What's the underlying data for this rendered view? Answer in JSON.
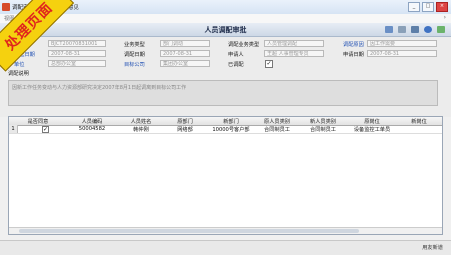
{
  "window": {
    "title": "调配审批",
    "tab": "审批意见",
    "menu": [
      "视图",
      "文件"
    ]
  },
  "page_title": "人员调配审批",
  "form": {
    "row1": [
      {
        "label": "单号",
        "value": "BJCT20070831001"
      },
      {
        "label": "业务类型",
        "value": "部门调动"
      },
      {
        "label": "调配业务类型",
        "value": "人员管理调配"
      },
      {
        "label": "调配原因",
        "value": "因工作需要"
      }
    ],
    "row2": [
      {
        "label": "发起日期",
        "value": "2007-08-31"
      },
      {
        "label": "调配日期",
        "value": "2007-08-31"
      },
      {
        "label": "申请人",
        "value": "王超 人事管理专员"
      },
      {
        "label": "申请日期",
        "value": "2007-08-31"
      }
    ],
    "row3": [
      {
        "label": "单位",
        "value": "总部办公室"
      },
      {
        "label": "目标公司",
        "value": "集团办公室"
      },
      {
        "label": "已调配",
        "value": ""
      }
    ],
    "memo_label": "调配说明",
    "memo_text": "因新工作任务变动与人力资源部研究决定2007年8月1日起调离到目标公司工作"
  },
  "grid": {
    "columns": [
      "是否同意",
      "人员编码",
      "人员姓名",
      "原部门",
      "新部门",
      "原人员类别",
      "新人员类别",
      "原岗位",
      "新岗位"
    ],
    "rows": [
      {
        "num": "1",
        "agree": true,
        "code": "50004582",
        "name": "韩仲刚",
        "old_dept": "网络部",
        "new_dept": "10000号客户部",
        "old_type": "合同制员工",
        "new_type": "合同制员工",
        "old_post": "设备监控工单员",
        "new_post": ""
      }
    ]
  },
  "status": {
    "right_text": "用友新道"
  },
  "badge_text": "处理页面"
}
